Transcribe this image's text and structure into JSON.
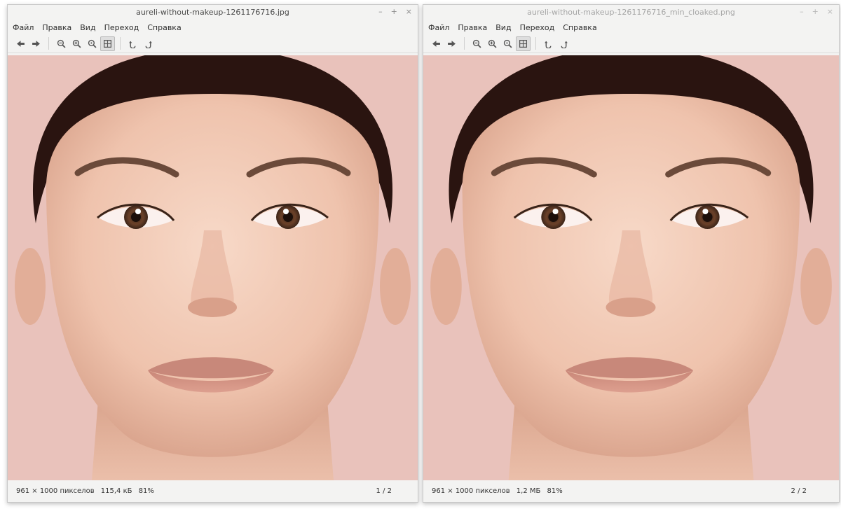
{
  "windows": [
    {
      "title": "aureli-without-makeup-1261176716.jpg",
      "controls": {
        "minimize": "–",
        "maximize": "+",
        "close": "×"
      },
      "menu": [
        "Файл",
        "Правка",
        "Вид",
        "Переход",
        "Справка"
      ],
      "status": {
        "dimensions": "961 × 1000 пикселов",
        "size": "115,4 кБ",
        "zoom": "81%",
        "page": "1 / 2"
      }
    },
    {
      "title": "aureli-without-makeup-1261176716_min_cloaked.png",
      "controls": {
        "minimize": "–",
        "maximize": "+",
        "close": "×"
      },
      "menu": [
        "Файл",
        "Правка",
        "Вид",
        "Переход",
        "Справка"
      ],
      "status": {
        "dimensions": "961 × 1000 пикселов",
        "size": "1,2 МБ",
        "zoom": "81%",
        "page": "2 / 2"
      }
    }
  ],
  "toolbar_icons": [
    "back-arrow-icon",
    "forward-arrow-icon",
    "zoom-out-icon",
    "zoom-in-icon",
    "zoom-original-icon",
    "zoom-fit-icon",
    "rotate-left-icon",
    "rotate-right-icon"
  ],
  "colors": {
    "photo_background": "#e9c2bb",
    "skin": "#f2cbb8",
    "hair": "#2a1410",
    "window_bg": "#f3f3f2"
  }
}
